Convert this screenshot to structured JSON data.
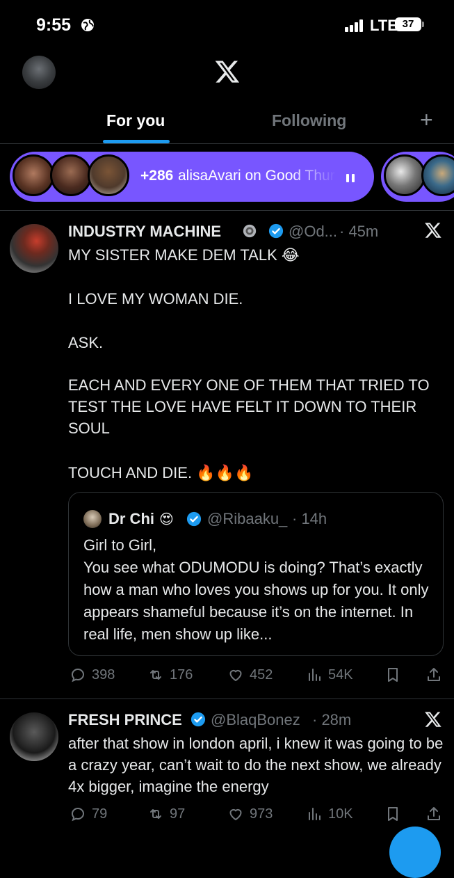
{
  "status_bar": {
    "time": "9:55",
    "carrier": "LTE",
    "battery": "37"
  },
  "header": {
    "logo": "x-logo"
  },
  "tabs": {
    "for_you": "For you",
    "following": "Following",
    "add": "+"
  },
  "spaces": {
    "count": "+286",
    "text": "alisaAvari on Good Thur"
  },
  "posts": [
    {
      "name": "INDUSTRY MACHINE",
      "handle": "@Od...",
      "time": "· 45m",
      "lines": [
        "MY SISTER MAKE DEM TALK 😂",
        "I LOVE MY WOMAN DIE.",
        "ASK.",
        "EACH AND EVERY ONE OF THEM THAT TRIED TO TEST THE LOVE HAVE FELT IT DOWN TO THEIR SOUL",
        "TOUCH AND DIE. 🔥🔥🔥"
      ],
      "quote": {
        "name": "Dr Chi",
        "emoji": "😍",
        "handle": "@Ribaaku_",
        "time": "· 14h",
        "text": "Girl to Girl,\nYou see what ODUMODU is doing? That’s exactly how a man who loves you shows up for you. It only appears shameful because it’s on the internet. In real life, men show up like..."
      },
      "stats": {
        "replies": "398",
        "reposts": "176",
        "likes": "452",
        "views": "54K"
      }
    },
    {
      "name": "FRESH PRINCE",
      "handle": "@BlaqBonez",
      "time": "· 28m",
      "text": "after that show in london april, i knew it was going to be a crazy year, can’t wait to do the next show, we already 4x bigger, imagine the energy",
      "stats": {
        "replies": "79",
        "reposts": "97",
        "likes": "973",
        "views": "10K"
      }
    }
  ],
  "colors": {
    "accent": "#1d9bf0",
    "spaces": "#7856ff",
    "muted": "#71767b",
    "background": "#000000"
  }
}
